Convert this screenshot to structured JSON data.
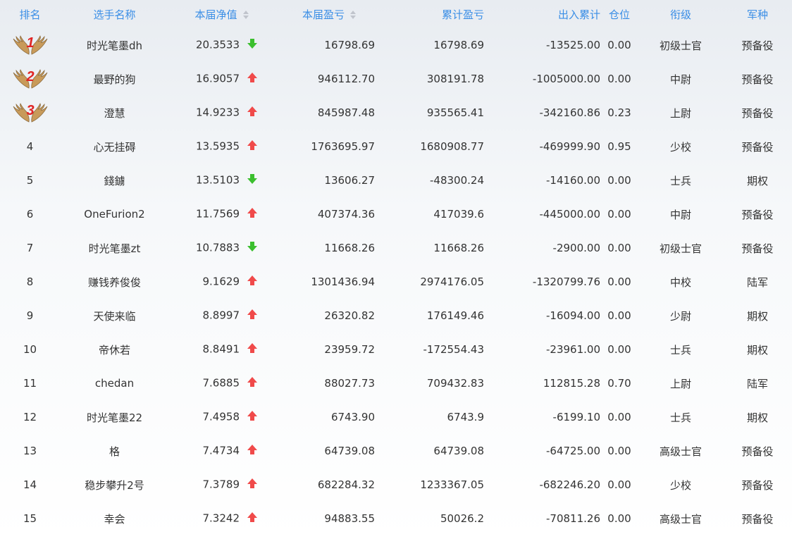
{
  "headers": {
    "rank": "排名",
    "name": "选手名称",
    "nav": "本届净值",
    "pnl": "本届盈亏",
    "cum_pnl": "累计盈亏",
    "flow": "出入累计",
    "position": "仓位",
    "title": "衔级",
    "branch": "军种"
  },
  "colors": {
    "header_text": "#3a8ee6",
    "up_arrow": "#f04a4a",
    "down_arrow": "#3bbf2e",
    "medal_number": "#e02424",
    "wing": "#c89a5a"
  },
  "rows": [
    {
      "rank": "1",
      "name": "时光笔墨dh",
      "nav": "20.3533",
      "trend": "down",
      "pnl": "16798.69",
      "cum_pnl": "16798.69",
      "flow": "-13525.00",
      "position": "0.00",
      "title": "初级士官",
      "branch": "预备役"
    },
    {
      "rank": "2",
      "name": "最野的狗",
      "nav": "16.9057",
      "trend": "up",
      "pnl": "946112.70",
      "cum_pnl": "308191.78",
      "flow": "-1005000.00",
      "position": "0.00",
      "title": "中尉",
      "branch": "预备役"
    },
    {
      "rank": "3",
      "name": "澄慧",
      "nav": "14.9233",
      "trend": "up",
      "pnl": "845987.48",
      "cum_pnl": "935565.41",
      "flow": "-342160.86",
      "position": "0.23",
      "title": "上尉",
      "branch": "预备役"
    },
    {
      "rank": "4",
      "name": "心无挂碍",
      "nav": "13.5935",
      "trend": "up",
      "pnl": "1763695.97",
      "cum_pnl": "1680908.77",
      "flow": "-469999.90",
      "position": "0.95",
      "title": "少校",
      "branch": "预备役"
    },
    {
      "rank": "5",
      "name": "錢鐪",
      "nav": "13.5103",
      "trend": "down",
      "pnl": "13606.27",
      "cum_pnl": "-48300.24",
      "flow": "-14160.00",
      "position": "0.00",
      "title": "士兵",
      "branch": "期权"
    },
    {
      "rank": "6",
      "name": "OneFurion2",
      "nav": "11.7569",
      "trend": "up",
      "pnl": "407374.36",
      "cum_pnl": "417039.6",
      "flow": "-445000.00",
      "position": "0.00",
      "title": "中尉",
      "branch": "预备役"
    },
    {
      "rank": "7",
      "name": "时光笔墨zt",
      "nav": "10.7883",
      "trend": "down",
      "pnl": "11668.26",
      "cum_pnl": "11668.26",
      "flow": "-2900.00",
      "position": "0.00",
      "title": "初级士官",
      "branch": "预备役"
    },
    {
      "rank": "8",
      "name": "赚钱养俊俊",
      "nav": "9.1629",
      "trend": "up",
      "pnl": "1301436.94",
      "cum_pnl": "2974176.05",
      "flow": "-1320799.76",
      "position": "0.00",
      "title": "中校",
      "branch": "陆军"
    },
    {
      "rank": "9",
      "name": "天使来临",
      "nav": "8.8997",
      "trend": "up",
      "pnl": "26320.82",
      "cum_pnl": "176149.46",
      "flow": "-16094.00",
      "position": "0.00",
      "title": "少尉",
      "branch": "期权"
    },
    {
      "rank": "10",
      "name": "帝休若",
      "nav": "8.8491",
      "trend": "up",
      "pnl": "23959.72",
      "cum_pnl": "-172554.43",
      "flow": "-23961.00",
      "position": "0.00",
      "title": "士兵",
      "branch": "期权"
    },
    {
      "rank": "11",
      "name": "chedan",
      "nav": "7.6885",
      "trend": "up",
      "pnl": "88027.73",
      "cum_pnl": "709432.83",
      "flow": "112815.28",
      "position": "0.70",
      "title": "上尉",
      "branch": "陆军"
    },
    {
      "rank": "12",
      "name": "时光笔墨22",
      "nav": "7.4958",
      "trend": "up",
      "pnl": "6743.90",
      "cum_pnl": "6743.9",
      "flow": "-6199.10",
      "position": "0.00",
      "title": "士兵",
      "branch": "期权"
    },
    {
      "rank": "13",
      "name": "格",
      "nav": "7.4734",
      "trend": "up",
      "pnl": "64739.08",
      "cum_pnl": "64739.08",
      "flow": "-64725.00",
      "position": "0.00",
      "title": "高级士官",
      "branch": "预备役"
    },
    {
      "rank": "14",
      "name": "稳步攀升2号",
      "nav": "7.3789",
      "trend": "up",
      "pnl": "682284.32",
      "cum_pnl": "1233367.05",
      "flow": "-682246.20",
      "position": "0.00",
      "title": "少校",
      "branch": "预备役"
    },
    {
      "rank": "15",
      "name": "幸会",
      "nav": "7.3242",
      "trend": "up",
      "pnl": "94883.55",
      "cum_pnl": "50026.2",
      "flow": "-70811.26",
      "position": "0.00",
      "title": "高级士官",
      "branch": "预备役"
    }
  ]
}
